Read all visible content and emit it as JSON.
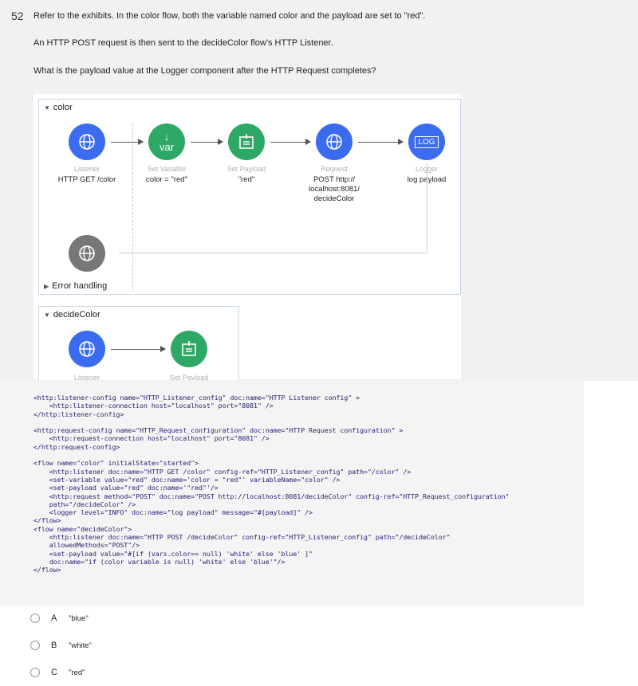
{
  "question": {
    "number": "52",
    "line1": "Refer to the exhibits. In the color flow, both the variable named color and the payload are set to \"red\".",
    "line2": "An HTTP POST request is then sent to the decideColor flow's HTTP Listener.",
    "line3": "What is the payload value at the Logger component after the HTTP Request completes?"
  },
  "flow_color": {
    "title": "color",
    "nodes": [
      {
        "label": "Listener",
        "desc": "HTTP GET /color",
        "icon": "globe-icon"
      },
      {
        "label": "Set Variable",
        "desc": "color = \"red\"",
        "icon": "var-icon",
        "icon_text": "var"
      },
      {
        "label": "Set Payload",
        "desc": "\"red\"",
        "icon": "set-payload-icon"
      },
      {
        "label": "Request",
        "desc": "POST http://\nlocalhost:8081/\ndecideColor",
        "icon": "globe-icon"
      },
      {
        "label": "Logger",
        "desc": "log payload",
        "icon": "logger-icon",
        "icon_text": "LOG"
      }
    ],
    "error_handling": "Error handling"
  },
  "flow_decide": {
    "title": "decideColor",
    "partial_labels": [
      "Listener",
      "Set Payload"
    ]
  },
  "code_lines": [
    "<http:listener-config name=\"HTTP_Listener_config\" doc:name=\"HTTP Listener config\" >",
    "    <http:listener-connection host=\"localhost\" port=\"8081\" />",
    "</http:listener-config>",
    "",
    "<http:request-config name=\"HTTP_Request_configuration\" doc:name=\"HTTP Request configuration\" >",
    "    <http:request-connection host=\"localhost\" port=\"8081\" />",
    "</http:request-config>",
    "",
    "<flow name=\"color\" initialState=\"started\">",
    "    <http:listener doc:name=\"HTTP GET /color\" config-ref=\"HTTP_Listener_config\" path=\"/color\" />",
    "    <set-variable value=\"red\" doc:name='color = \"red\"' variableName=\"color\" />",
    "    <set-payload value=\"red\" doc:name='\"red\"'/>",
    "    <http:request method=\"POST\" doc:name=\"POST http://localhost:8081/decideColor\" config-ref=\"HTTP_Request_configuration\"",
    "    path=\"/decideColor\" />",
    "    <logger level=\"INFO\" doc:name=\"log payload\" message=\"#[payload]\" />",
    "</flow>",
    "<flow name=\"decideColor\">",
    "    <http:listener doc:name=\"HTTP POST /decideColor\" config-ref=\"HTTP_Listener_config\" path=\"/decideColor\"",
    "    allowedMethods=\"POST\"/>",
    "    <set-payload value=\"#[if (vars.color== null) 'white' else 'blue' ]\"",
    "    doc:name=\"if (color variable is null) 'white' else 'blue'\"/>",
    "</flow>"
  ],
  "options": [
    {
      "letter": "A",
      "text": "\"blue\""
    },
    {
      "letter": "B",
      "text": "\"white\""
    },
    {
      "letter": "C",
      "text": "\"red\""
    }
  ],
  "colors": {
    "blue_node": "#3b6cf0",
    "green_node": "#2ea865",
    "gray_node": "#777777"
  }
}
